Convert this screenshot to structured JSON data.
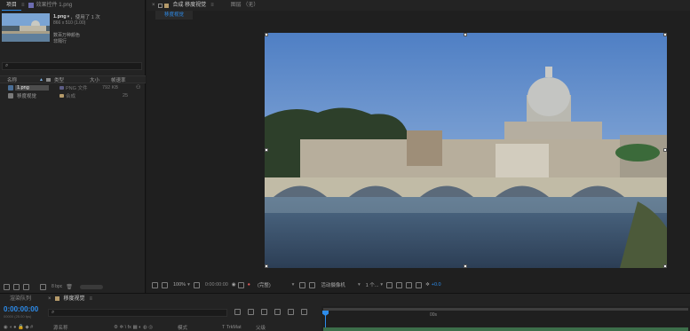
{
  "project_panel": {
    "tabs": [
      {
        "label": "项目"
      },
      {
        "label": "效果控件 1.png"
      }
    ],
    "preview": {
      "filename": "1.png",
      "used": "，使用了 1 次",
      "dims": "866 x 510 (1.00)",
      "color_info": "数百万种颜色",
      "alpha_info": "非隔行"
    },
    "search_placeholder": "",
    "columns": {
      "name": "名称",
      "type": "类型",
      "size": "大小",
      "rate": "帧速率"
    },
    "items": [
      {
        "name": "1.png",
        "type": "PNG 文件",
        "size": "792 KB",
        "rate": ""
      },
      {
        "name": "移度视觉",
        "type": "合成",
        "size": "",
        "rate": "25"
      }
    ],
    "bpc": "8 bpc"
  },
  "comp_viewer": {
    "tabs": [
      {
        "label": "合成 移度视觉"
      },
      {
        "label": "图层 （无）"
      }
    ],
    "subtab": "移度视觉",
    "footer": {
      "zoom": "100%",
      "timecode": "0:00:00:00",
      "resolution": "(完整)",
      "camera": "活动摄像机",
      "views": "1 个...",
      "exposure": "+0.0"
    }
  },
  "timeline": {
    "tabs": [
      {
        "label": "渲染队列"
      },
      {
        "label": "移度视觉"
      }
    ],
    "timecode": "0:00:00:00",
    "timecode_sub": "00000 (25.00 fps)",
    "search_placeholder": "",
    "ruler_label": "00s",
    "columns": {
      "source": "源名称",
      "mode": "模式",
      "trkmat": "T TrkMat",
      "parent": "父级"
    }
  },
  "colors": {
    "accent": "#2d8ceb",
    "panel": "#232323",
    "bg": "#1c1c1c"
  }
}
